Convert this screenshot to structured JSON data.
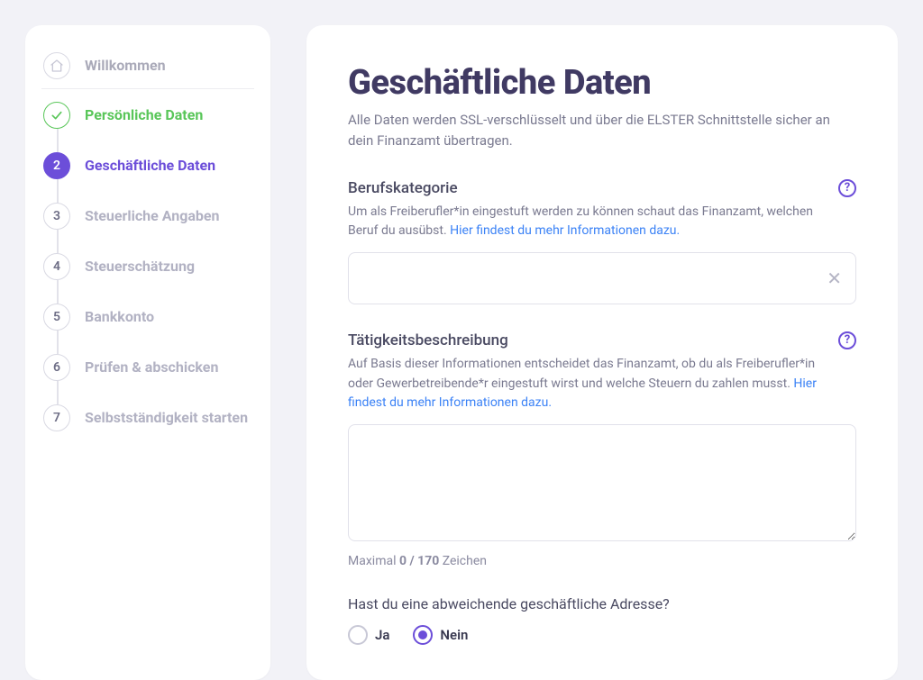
{
  "sidebar": {
    "items": [
      {
        "label": "Willkommen",
        "type": "home"
      },
      {
        "label": "Persönliche Daten",
        "type": "done"
      },
      {
        "label": "Geschäftliche Daten",
        "type": "active",
        "number": "2"
      },
      {
        "label": "Steuerliche Angaben",
        "type": "future",
        "number": "3"
      },
      {
        "label": "Steuerschätzung",
        "type": "future",
        "number": "4"
      },
      {
        "label": "Bankkonto",
        "type": "future",
        "number": "5"
      },
      {
        "label": "Prüfen & abschicken",
        "type": "future",
        "number": "6"
      },
      {
        "label": "Selbstständigkeit starten",
        "type": "future",
        "number": "7"
      }
    ]
  },
  "main": {
    "title": "Geschäftliche Daten",
    "subtitle": "Alle Daten werden SSL-verschlüsselt und über die ELSTER Schnittstelle sicher an dein Finanzamt übertragen.",
    "category": {
      "label": "Berufskategorie",
      "desc_prefix": "Um als Freiberufler*in eingestuft werden zu können schaut das Finanzamt, welchen Beruf du ausübst. ",
      "link_text": "Hier findest du mehr Informationen dazu.",
      "value": ""
    },
    "activity": {
      "label": "Tätigkeitsbeschreibung",
      "desc_prefix": "Auf Basis dieser Informationen entscheidet das Finanzamt, ob du als Freiberufler*in oder Gewerbetreibende*r eingestuft wirst und welche Steuern du zahlen musst. ",
      "link_text": "Hier findest du mehr Informationen dazu.",
      "value": "",
      "counter_pre": "Maximal ",
      "counter_count": "0 / 170",
      "counter_post": " Zeichen"
    },
    "address_q": {
      "question": "Hast du eine abweichende geschäftliche Adresse?",
      "yes": "Ja",
      "no": "Nein",
      "selected": "no"
    }
  }
}
